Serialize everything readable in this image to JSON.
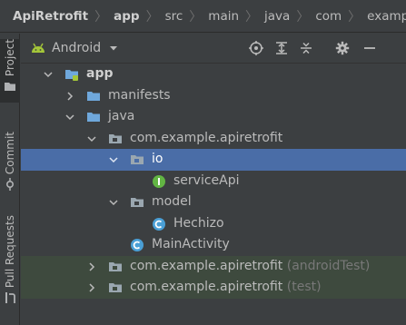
{
  "breadcrumb": {
    "items": [
      "ApiRetrofit",
      "app",
      "src",
      "main",
      "java",
      "com",
      "example"
    ]
  },
  "left_strip": {
    "tabs": [
      {
        "label": "Project",
        "active": true
      },
      {
        "label": "Commit",
        "active": false
      },
      {
        "label": "Pull Requests",
        "active": false
      }
    ]
  },
  "project_panel": {
    "view_mode": "Android",
    "toolbar_icons": [
      "locate-icon",
      "expand-all-icon",
      "collapse-all-icon",
      "settings-gear-icon",
      "hide-icon"
    ]
  },
  "tree": [
    {
      "label": "app",
      "icon": "module-folder-icon",
      "expanded": true,
      "bold": true
    },
    {
      "label": "manifests",
      "icon": "folder-icon",
      "expanded": false
    },
    {
      "label": "java",
      "icon": "folder-icon",
      "expanded": true
    },
    {
      "label": "com.example.apiretrofit",
      "icon": "package-icon",
      "expanded": true
    },
    {
      "label": "io",
      "icon": "package-icon",
      "expanded": true,
      "selected": true
    },
    {
      "label": "serviceApi",
      "icon": "interface-icon"
    },
    {
      "label": "model",
      "icon": "package-icon",
      "expanded": true
    },
    {
      "label": "Hechizo",
      "icon": "class-icon"
    },
    {
      "label": "MainActivity",
      "icon": "class-icon"
    },
    {
      "label": "com.example.apiretrofit",
      "suffix": "(androidTest)",
      "icon": "package-icon",
      "expanded": false
    },
    {
      "label": "com.example.apiretrofit",
      "suffix": "(test)",
      "icon": "package-icon",
      "expanded": false
    }
  ],
  "colors": {
    "background": "#3c3f41",
    "selection": "#4a6da7",
    "folder_blue": "#6fa8dc",
    "android_green": "#a4c639",
    "class_icon": "#4a9fd6",
    "interface_icon": "#62b543"
  }
}
